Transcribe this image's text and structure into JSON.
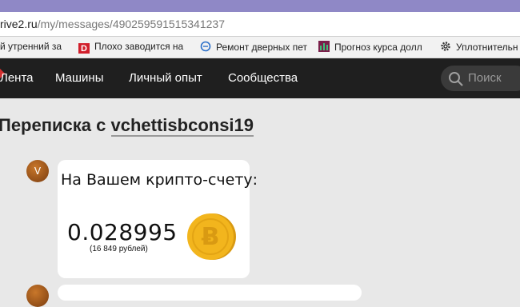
{
  "browser": {
    "url_domain": "rive2.ru",
    "url_path": "/my/messages/490259591515341237"
  },
  "bookmarks": [
    {
      "label": "й утренний за",
      "icon": "page-icon"
    },
    {
      "label": "Плохо заводится на",
      "icon": "d-favicon"
    },
    {
      "label": "Ремонт дверных пет",
      "icon": "e-favicon"
    },
    {
      "label": "Прогноз курса долл",
      "icon": "chart-favicon"
    },
    {
      "label": "Уплотнительн",
      "icon": "gear-icon"
    }
  ],
  "nav": {
    "items": [
      "Лента",
      "Машины",
      "Личный опыт",
      "Сообщества"
    ],
    "search_placeholder": "Поиск"
  },
  "page": {
    "title_prefix": "Переписка с",
    "username": "vchettisbconsi19"
  },
  "message": {
    "avatar_letter": "V",
    "label": "На Вашем крипто-счету:",
    "amount": "0.028995",
    "amount_sub": "(16 849 рублей)"
  },
  "colors": {
    "top_strip": "#8f88c6",
    "navbar": "#1f1f1f",
    "accent_red": "#d32f2f",
    "coin_gold": "#f2b51d",
    "page_bg": "#e8e8e8"
  }
}
